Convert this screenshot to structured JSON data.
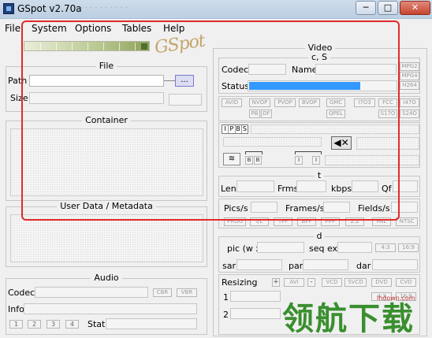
{
  "window": {
    "title": "GSpot v2.70a",
    "blurred_title": "·  ·  ·    ·  ·    ·  ·  ·  ·    ·  ·"
  },
  "menu": [
    "File",
    "System",
    "Options",
    "Tables",
    "Help"
  ],
  "logo": "GSpot",
  "file": {
    "title": "File",
    "path_label": "Path",
    "size_label": "Size",
    "browse_label": "..."
  },
  "container": {
    "title": "Container"
  },
  "userdata": {
    "title": "User Data / Metadata"
  },
  "audio": {
    "title": "Audio",
    "codec_label": "Codec",
    "cbr": "CBR",
    "vbr": "VBR",
    "info_label": "Info",
    "stream_buttons": [
      "1",
      "2",
      "3",
      "4"
    ],
    "stat_label": "Stat"
  },
  "video": {
    "title": "Video",
    "cs_title": "c, S",
    "codec_label": "Codec",
    "name_label": "Name",
    "status_label": "Status",
    "codec_tags": [
      "MPG2",
      "MPG4",
      "H264"
    ],
    "flags_row1": [
      "AVID",
      "NVOP",
      "PVOP",
      "BVOP",
      "GMC",
      "I7O3",
      "FCC",
      "I47O"
    ],
    "flags_row2": [
      "PB",
      "DF",
      "QPEL",
      "S17O",
      "S24O"
    ],
    "ipbs": [
      "I",
      "P",
      "B",
      "S"
    ],
    "bbtn": [
      "B",
      "B"
    ],
    "i_btns": [
      "I",
      "I"
    ],
    "t_title": "t",
    "len_label": "Len",
    "frms_label": "Frms",
    "kbps_label": "kbps",
    "qf_label": "Qf",
    "pics_label": "Pics/s",
    "frames_label": "Frames/s",
    "fields_label": "Fields/s",
    "rate_tags": [
      "PROG",
      "I/L",
      "TFF",
      "BFF",
      "PPP",
      "2:2",
      "PAL",
      "NTSC"
    ],
    "d_title": "d",
    "pic_label": "pic (w x",
    "seqext_label": "seq ext",
    "ratio_tags": [
      "4:3",
      "16:9"
    ],
    "sar_label": "sar",
    "par_label": "par",
    "dar_label": "dar",
    "resizing_label": "Resizing",
    "plus": "+",
    "avi": "AVI",
    "minus": "-",
    "fmt_tags": [
      "VCD",
      "SVCD",
      "DVD",
      "CVD"
    ],
    "row1_label": "1",
    "row2_label": "2",
    "ratio_tags2": [
      "4:3",
      "16:9"
    ]
  },
  "watermark": {
    "text": "领航下载",
    "url": "lhdown.com"
  },
  "colors": {
    "status_fill": "#3399ff",
    "highlight_frame": "#e02b2b",
    "watermark": "#3a8f2f"
  }
}
